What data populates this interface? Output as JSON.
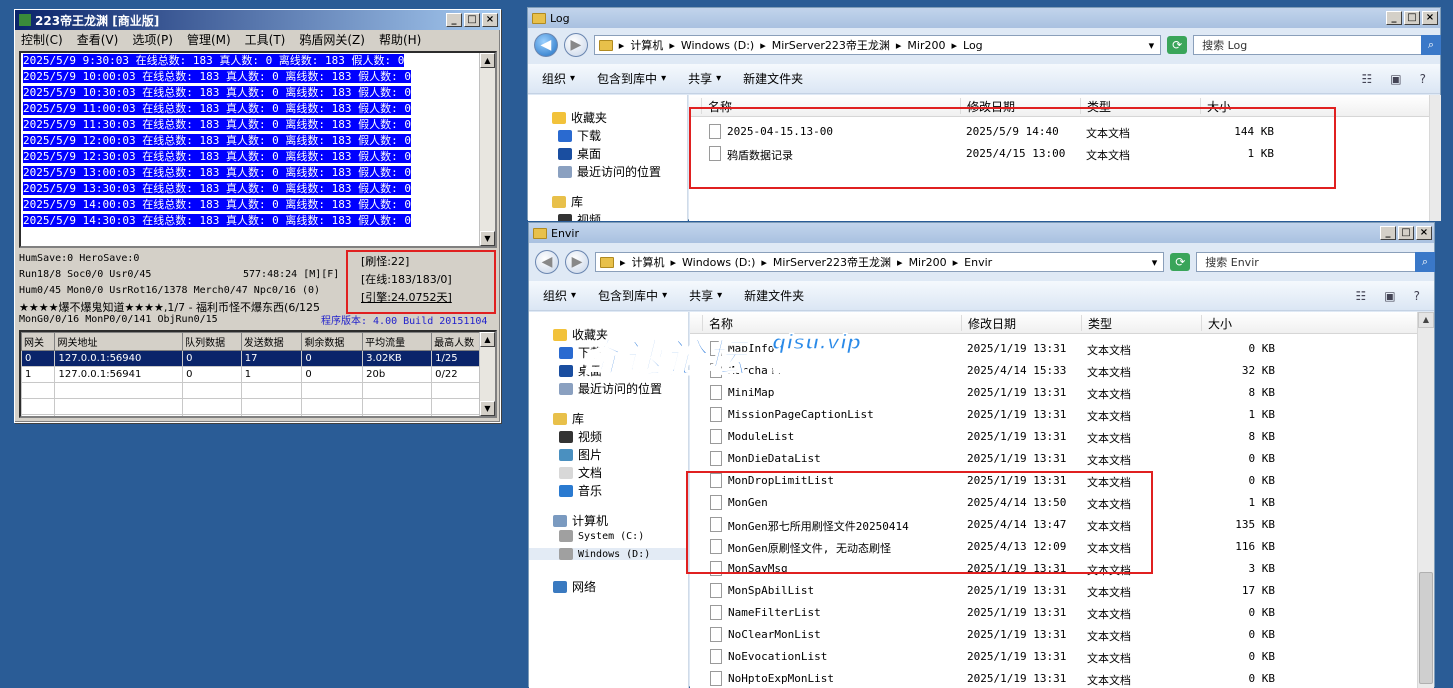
{
  "left_window": {
    "title": "223帝王龙渊 [商业版]",
    "menu": [
      "控制(C)",
      "查看(V)",
      "选项(P)",
      "管理(M)",
      "工具(T)",
      "鸦盾网关(Z)",
      "帮助(H)"
    ],
    "log_lines": [
      "2025/5/9 9:30:03 在线总数: 183 真人数: 0 离线数: 183 假人数: 0",
      "2025/5/9 10:00:03 在线总数: 183 真人数: 0 离线数: 183 假人数: 0",
      "2025/5/9 10:30:03 在线总数: 183 真人数: 0 离线数: 183 假人数: 0",
      "2025/5/9 11:00:03 在线总数: 183 真人数: 0 离线数: 183 假人数: 0",
      "2025/5/9 11:30:03 在线总数: 183 真人数: 0 离线数: 183 假人数: 0",
      "2025/5/9 12:00:03 在线总数: 183 真人数: 0 离线数: 183 假人数: 0",
      "2025/5/9 12:30:03 在线总数: 183 真人数: 0 离线数: 183 假人数: 0",
      "2025/5/9 13:00:03 在线总数: 183 真人数: 0 离线数: 183 假人数: 0",
      "2025/5/9 13:30:03 在线总数: 183 真人数: 0 离线数: 183 假人数: 0",
      "2025/5/9 14:00:03 在线总数: 183 真人数: 0 离线数: 183 假人数: 0",
      "2025/5/9 14:30:03 在线总数: 183 真人数: 0 离线数: 183 假人数: 0"
    ],
    "status": {
      "line1": "HumSave:0 HeroSave:0",
      "line2a": "Run18/8 Soc0/0 Usr0/45",
      "line2b": "577:48:24 [M][F]",
      "line3": "Hum0/45 Mon0/0 UsrRot16/1378 Merch0/47 Npc0/16 (0)",
      "line4": "★★★★爆不爆鬼知道★★★★,1/7 - 福利币怪不爆东西(6/125",
      "line5": "MonG0/0/16 MonP0/0/141 ObjRun0/15",
      "version": "程序版本: 4.00 Build 20151104",
      "box_line1": "[刷怪:22]",
      "box_line2": "[在线:183/183/0]",
      "box_line3": "[引擎:24.0752天]"
    },
    "table": {
      "headers": [
        "网关",
        "网关地址",
        "队列数据",
        "发送数据",
        "剩余数据",
        "平均流量",
        "最高人数"
      ],
      "rows": [
        [
          "0",
          "127.0.0.1:56940",
          "0",
          "17",
          "0",
          "3.02KB",
          "1/25"
        ],
        [
          "1",
          "127.0.0.1:56941",
          "0",
          "1",
          "0",
          "20b",
          "0/22"
        ]
      ]
    }
  },
  "log_window": {
    "title": "Log",
    "path": [
      "计算机",
      "Windows (D:)",
      "MirServer223帝王龙渊",
      "Mir200",
      "Log"
    ],
    "search_placeholder": "搜索 Log",
    "toolbar": [
      "组织",
      "包含到库中",
      "共享",
      "新建文件夹"
    ],
    "nav": [
      "收藏夹",
      "下载",
      "桌面",
      "最近访问的位置",
      "库",
      "视频"
    ],
    "columns": [
      "名称",
      "修改日期",
      "类型",
      "大小"
    ],
    "files": [
      {
        "name": "2025-04-15.13-00",
        "date": "2025/5/9 14:40",
        "type": "文本文档",
        "size": "144 KB"
      },
      {
        "name": "鸦盾数据记录",
        "date": "2025/4/15 13:00",
        "type": "文本文档",
        "size": "1 KB"
      }
    ]
  },
  "envir_window": {
    "title": "Envir",
    "path": [
      "计算机",
      "Windows (D:)",
      "MirServer223帝王龙渊",
      "Mir200",
      "Envir"
    ],
    "search_placeholder": "搜索 Envir",
    "toolbar": [
      "组织",
      "包含到库中",
      "共享",
      "新建文件夹"
    ],
    "nav": [
      "收藏夹",
      "下载",
      "桌面",
      "最近访问的位置",
      "库",
      "视频",
      "图片",
      "文档",
      "音乐",
      "计算机",
      "System (C:)",
      "Windows (D:)",
      "网络"
    ],
    "columns": [
      "名称",
      "修改日期",
      "类型",
      "大小"
    ],
    "files": [
      {
        "name": "MapInfo",
        "date": "2025/1/19 13:31",
        "type": "文本文档",
        "size": "0 KB"
      },
      {
        "name": "Merchant",
        "date": "2025/4/14 15:33",
        "type": "文本文档",
        "size": "32 KB"
      },
      {
        "name": "MiniMap",
        "date": "2025/1/19 13:31",
        "type": "文本文档",
        "size": "8 KB"
      },
      {
        "name": "MissionPageCaptionList",
        "date": "2025/1/19 13:31",
        "type": "文本文档",
        "size": "1 KB"
      },
      {
        "name": "ModuleList",
        "date": "2025/1/19 13:31",
        "type": "文本文档",
        "size": "8 KB"
      },
      {
        "name": "MonDieDataList",
        "date": "2025/1/19 13:31",
        "type": "文本文档",
        "size": "0 KB"
      },
      {
        "name": "MonDropLimitList",
        "date": "2025/1/19 13:31",
        "type": "文本文档",
        "size": "0 KB"
      },
      {
        "name": "MonGen",
        "date": "2025/4/14 13:50",
        "type": "文本文档",
        "size": "1 KB"
      },
      {
        "name": "MonGen邪七所用刷怪文件20250414",
        "date": "2025/4/14 13:47",
        "type": "文本文档",
        "size": "135 KB"
      },
      {
        "name": "MonGen原刷怪文件, 无动态刷怪",
        "date": "2025/4/13 12:09",
        "type": "文本文档",
        "size": "116 KB"
      },
      {
        "name": "MonSayMsg",
        "date": "2025/1/19 13:31",
        "type": "文本文档",
        "size": "3 KB"
      },
      {
        "name": "MonSpAbilList",
        "date": "2025/1/19 13:31",
        "type": "文本文档",
        "size": "17 KB"
      },
      {
        "name": "NameFilterList",
        "date": "2025/1/19 13:31",
        "type": "文本文档",
        "size": "0 KB"
      },
      {
        "name": "NoClearMonList",
        "date": "2025/1/19 13:31",
        "type": "文本文档",
        "size": "0 KB"
      },
      {
        "name": "NoEvocationList",
        "date": "2025/1/19 13:31",
        "type": "文本文档",
        "size": "0 KB"
      },
      {
        "name": "NoHptoExpMonList",
        "date": "2025/1/19 13:31",
        "type": "文本文档",
        "size": "0 KB"
      }
    ]
  },
  "watermark": {
    "text_main": "奇速论坛",
    "url": "qisu.vip",
    "slogan": "传奇架设速成"
  },
  "colors": {
    "desktop": "#2a5c96",
    "log_highlight": "#0000ff",
    "red_box": "#e02020",
    "selection": "#0a246a"
  }
}
